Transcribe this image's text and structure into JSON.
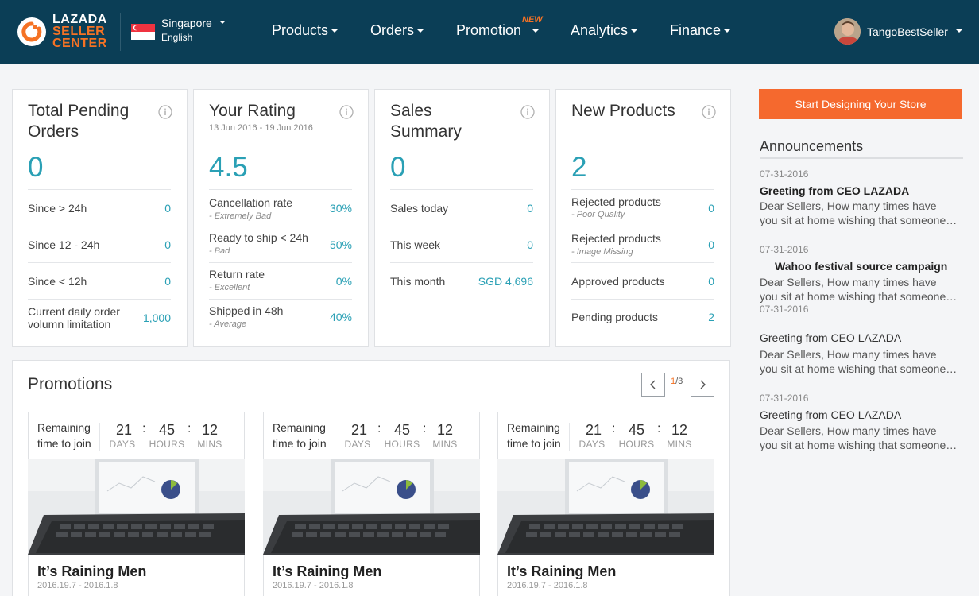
{
  "header": {
    "logo": {
      "line1": "LAZADA",
      "line2": "SELLER",
      "line3": "CENTER"
    },
    "region": {
      "country": "Singapore",
      "language": "English"
    },
    "nav": [
      {
        "label": "Products"
      },
      {
        "label": "Orders"
      },
      {
        "label": "Promotion",
        "badge": "NEW"
      },
      {
        "label": "Analytics"
      },
      {
        "label": "Finance"
      }
    ],
    "user": {
      "name": "TangoBestSeller"
    }
  },
  "cards": {
    "pending": {
      "title": "Total Pending Orders",
      "value": "0",
      "rows": [
        {
          "label": "Since > 24h",
          "value": "0"
        },
        {
          "label": "Since 12 - 24h",
          "value": "0"
        },
        {
          "label": "Since < 12h",
          "value": "0"
        },
        {
          "label": "Current daily order",
          "label2": "volumn limitation",
          "value": "1,000"
        }
      ]
    },
    "rating": {
      "title": "Your Rating",
      "subtitle": "13 Jun 2016 - 19 Jun 2016",
      "value": "4.5",
      "rows": [
        {
          "label": "Cancellation rate",
          "sub": "- Extremely Bad",
          "value": "30%"
        },
        {
          "label": "Ready to ship < 24h",
          "sub": "- Bad",
          "value": "50%"
        },
        {
          "label": "Return rate",
          "sub": "- Excellent",
          "value": "0%"
        },
        {
          "label": "Shipped in 48h",
          "sub": "- Average",
          "value": "40%"
        }
      ]
    },
    "sales": {
      "title": "Sales Summary",
      "value": "0",
      "rows": [
        {
          "label": "Sales today",
          "value": "0"
        },
        {
          "label": "This week",
          "value": "0"
        },
        {
          "label": "This month",
          "value": "SGD 4,696"
        }
      ]
    },
    "new_products": {
      "title": "New Products",
      "value": "2",
      "rows": [
        {
          "label": "Rejected products",
          "sub": "- Poor Quality",
          "value": "0"
        },
        {
          "label": "Rejected products",
          "sub": "- Image Missing",
          "value": "0"
        },
        {
          "label": "Approved products",
          "value": "0"
        },
        {
          "label": "Pending products",
          "value": "2"
        }
      ]
    }
  },
  "promotions": {
    "title": "Promotions",
    "pager": {
      "current": "1",
      "total": "/3"
    },
    "items": [
      {
        "remaining_l1": "Remaining",
        "remaining_l2": "time to join",
        "days": "21",
        "hours": "45",
        "mins": "12",
        "days_label": "DAYS",
        "hours_label": "HOURS",
        "mins_label": "MINS",
        "name": "It’s Raining Men",
        "date": "2016.19.7 - 2016.1.8"
      },
      {
        "remaining_l1": "Remaining",
        "remaining_l2": "time to join",
        "days": "21",
        "hours": "45",
        "mins": "12",
        "days_label": "DAYS",
        "hours_label": "HOURS",
        "mins_label": "MINS",
        "name": "It’s Raining Men",
        "date": "2016.19.7 - 2016.1.8"
      },
      {
        "remaining_l1": "Remaining",
        "remaining_l2": "time to join",
        "days": "21",
        "hours": "45",
        "mins": "12",
        "days_label": "DAYS",
        "hours_label": "HOURS",
        "mins_label": "MINS",
        "name": "It’s Raining Men",
        "date": "2016.19.7 - 2016.1.8"
      }
    ]
  },
  "sidebar": {
    "cta": "Start Designing Your Store",
    "announcements_title": "Announcements",
    "announcements": [
      {
        "date": "07-31-2016",
        "title": "Greeting from CEO LAZADA",
        "body1": "Dear Sellers,  How many times have",
        "body2": "you sit at home wishing that someone would come and help you with your store"
      },
      {
        "date": "07-31-2016",
        "title": "Wahoo festival source campaign",
        "body1": "Dear Sellers,  How many times have",
        "body2": "you sit at home wishing that someone would come and help you with your store"
      },
      {
        "date": "07-31-2016",
        "title": "Greeting from CEO LAZADA",
        "body1": "Dear Sellers,  How many times have",
        "body2": "you sit at home wishing that someone would come and help you with your store"
      },
      {
        "date": "07-31-2016",
        "title": "Greeting from CEO LAZADA",
        "body1": "Dear Sellers,  How many times have",
        "body2": "you sit at home wishing that someone would come and help you with your store"
      }
    ]
  },
  "colors": {
    "header_bg": "#0b3e56",
    "accent": "#f57224",
    "value": "#2aa0b5",
    "cta": "#f5692e"
  },
  "icons": [
    "lazada-logo-icon",
    "singapore-flag-icon",
    "caret-down-icon",
    "info-icon",
    "chevron-left-icon",
    "chevron-right-icon",
    "user-avatar"
  ]
}
